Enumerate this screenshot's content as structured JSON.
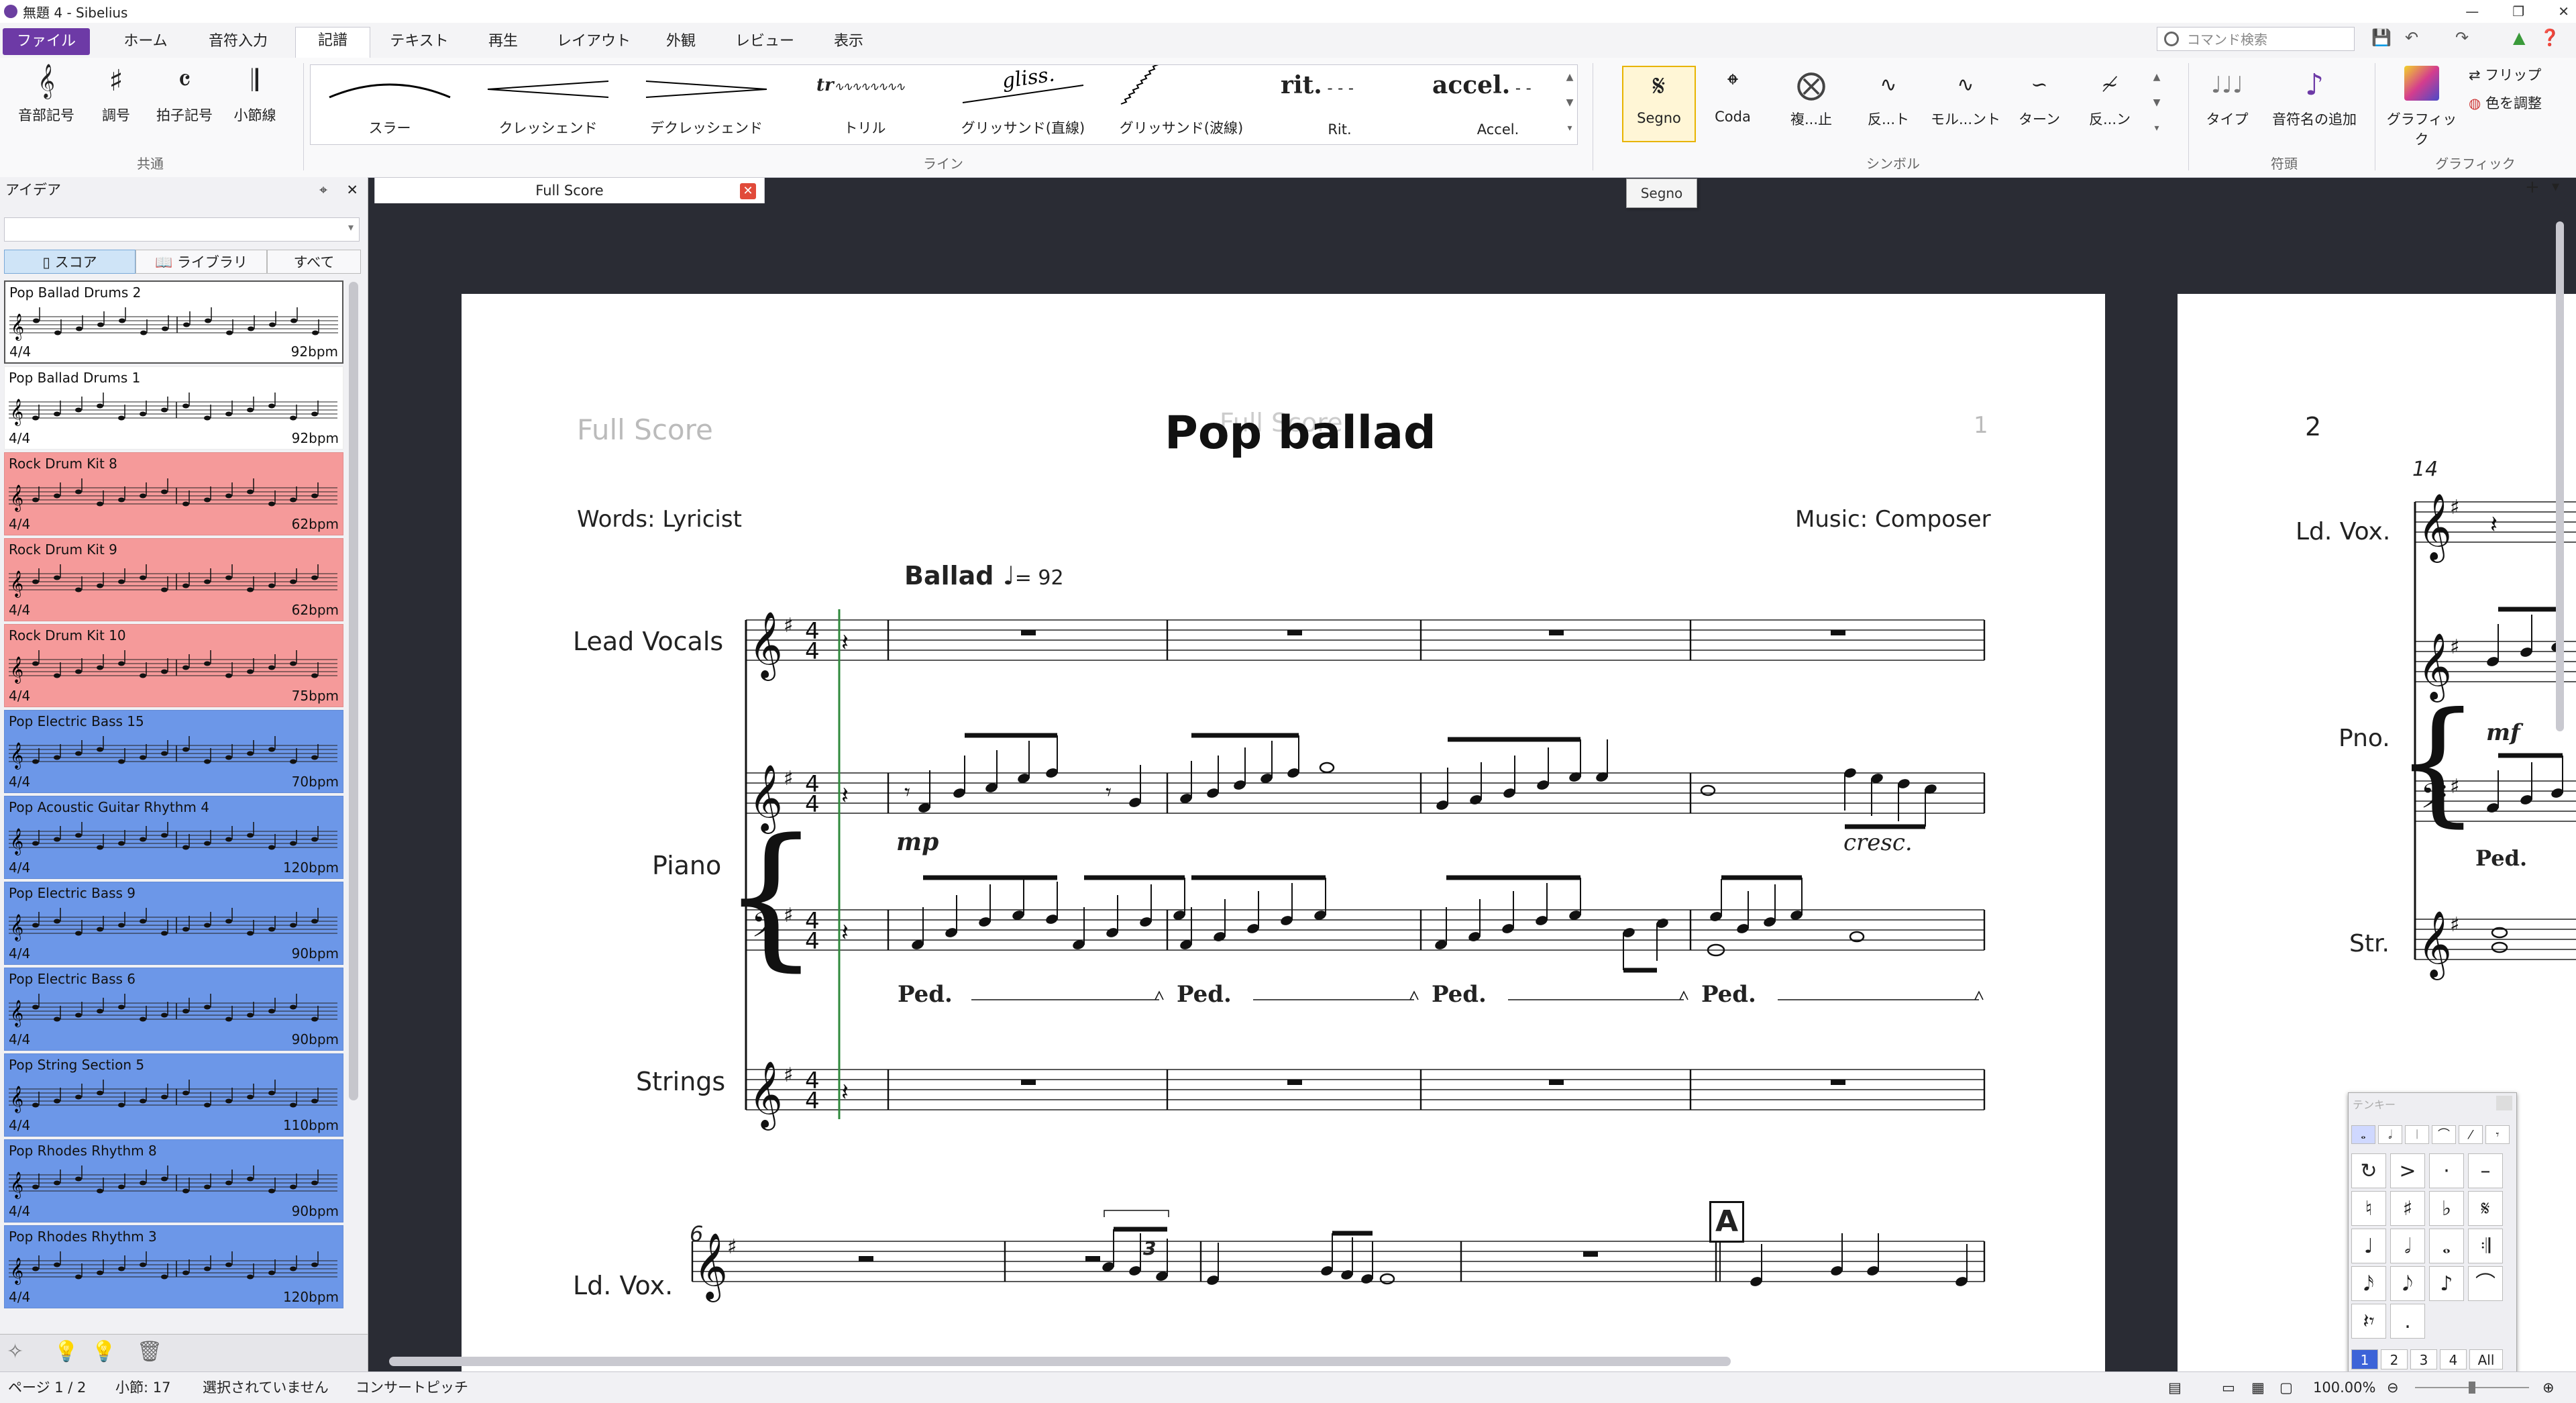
{
  "window": {
    "title": "無題 4 - Sibelius"
  },
  "tabs": [
    "ファイル",
    "ホーム",
    "音符入力",
    "記譜",
    "テキスト",
    "再生",
    "レイアウト",
    "外観",
    "レビュー",
    "表示"
  ],
  "active_tab": "記譜",
  "command_search_placeholder": "コマンド検索",
  "ribbon": {
    "common": {
      "items": [
        "音部記号",
        "調号",
        "拍子記号",
        "小節線"
      ],
      "label": "共通"
    },
    "lines": {
      "items": [
        "スラー",
        "クレッシェンド",
        "デクレッシェンド",
        "トリル",
        "グリッサンド(直線)",
        "グリッサンド(波線)",
        "Rit.",
        "Accel."
      ],
      "label": "ライン",
      "glyph_trill": "tr",
      "glyph_gliss": "gliss.",
      "glyph_rit": "rit.",
      "glyph_accel": "accel."
    },
    "symbols": {
      "items": [
        "Segno",
        "Coda",
        "複...止",
        "反...ト",
        "モル...ント",
        "ターン",
        "反...ン"
      ],
      "label": "シンボル"
    },
    "noteheads": {
      "items": [
        "タイプ",
        "音符名の追加"
      ],
      "label": "符頭"
    },
    "graphics": {
      "items": [
        "グラフィック",
        "フリップ",
        "色を調整"
      ],
      "label": "グラフィック"
    }
  },
  "tooltip": "Segno",
  "ideas_panel": {
    "title": "アイデア",
    "tabs": [
      "スコア",
      "ライブラリ",
      "すべて"
    ],
    "ideas": [
      {
        "name": "Pop Ballad Drums 2",
        "ts": "4/4",
        "bpm": "92bpm",
        "color": "#ffffff"
      },
      {
        "name": "Pop Ballad Drums 1",
        "ts": "4/4",
        "bpm": "92bpm",
        "color": "#ffffff"
      },
      {
        "name": "Rock Drum Kit 8",
        "ts": "4/4",
        "bpm": "62bpm",
        "color": "#f59a9a"
      },
      {
        "name": "Rock Drum Kit 9",
        "ts": "4/4",
        "bpm": "62bpm",
        "color": "#f59a9a"
      },
      {
        "name": "Rock Drum Kit 10",
        "ts": "4/4",
        "bpm": "75bpm",
        "color": "#f59a9a"
      },
      {
        "name": "Pop Electric Bass 15",
        "ts": "4/4",
        "bpm": "70bpm",
        "color": "#6c97e8"
      },
      {
        "name": "Pop Acoustic Guitar Rhythm 4",
        "ts": "4/4",
        "bpm": "120bpm",
        "color": "#6c97e8"
      },
      {
        "name": "Pop Electric Bass 9",
        "ts": "4/4",
        "bpm": "90bpm",
        "color": "#6c97e8"
      },
      {
        "name": "Pop Electric Bass 6",
        "ts": "4/4",
        "bpm": "90bpm",
        "color": "#6c97e8"
      },
      {
        "name": "Pop String Section 5",
        "ts": "4/4",
        "bpm": "110bpm",
        "color": "#6c97e8"
      },
      {
        "name": "Pop Rhodes Rhythm 8",
        "ts": "4/4",
        "bpm": "90bpm",
        "color": "#6c97e8"
      },
      {
        "name": "Pop Rhodes Rhythm 3",
        "ts": "4/4",
        "bpm": "120bpm",
        "color": "#6c97e8"
      }
    ]
  },
  "document_tab": "Full Score",
  "score": {
    "header_left": "Full Score",
    "header_ghost": "Full Score",
    "title": "Pop ballad",
    "page_number": "1",
    "words": "Words: Lyricist",
    "music": "Music: Composer",
    "tempo_text": "Ballad",
    "tempo_value": "= 92",
    "instruments": [
      "Lead Vocals",
      "Piano",
      "Strings"
    ],
    "system2_instrument": "Ld. Vox.",
    "system2_bar_number": "6",
    "rehearsal_mark": "A",
    "triplet": "3",
    "dynamic_mp": "mp",
    "cresc": "cresc.",
    "ped": "Ped."
  },
  "page2": {
    "page_number": "2",
    "bar_number": "14",
    "instruments": [
      "Ld. Vox.",
      "Pno.",
      "Str."
    ],
    "dynamic": "mf",
    "ped": "Ped."
  },
  "keypad": {
    "title": "テンキー",
    "layout_tabs": [
      "1",
      "2",
      "3",
      "4",
      "All"
    ]
  },
  "status": {
    "page": "ページ 1 / 2",
    "bar": "小節: 17",
    "selection": "選択されていません",
    "pitch": "コンサートピッチ",
    "zoom": "100.00%"
  }
}
